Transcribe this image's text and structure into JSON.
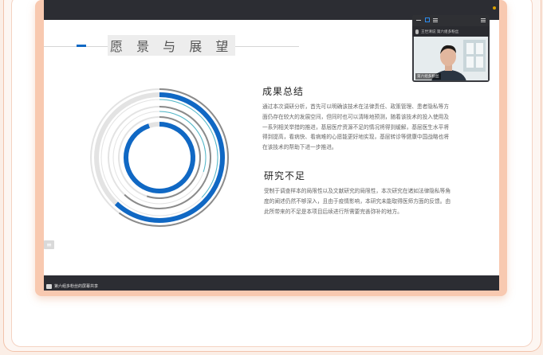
{
  "slide": {
    "title": "愿 景 与 展 望",
    "section1": {
      "heading": "成果总结",
      "body": "通过本次调研分析，首先可以明确该技术在法律责任、政策管理、患者隐私等方面仍存在较大的发展空间，但同时也可以清晰地预测，随着该技术的投入使用及一系列相关举措的推进，基层医疗资源不足的情况将得到缓解，基层医生水平将得到提高，看病快、看病难的心愿能更好地实现，基层转诊等健康中国战略也将在该技术的帮助下进一步推进。"
    },
    "section2": {
      "heading": "研究不足",
      "body": "受制于调查样本的局限性以及文献研究的局限性，本次研究在诸如法律隐私等角度的阐述仍然不够深入，且由于疫情影响，本研究未能取得医师方面的反馈。由此所带来的不足是本项目后续进行所需要完善弥补的地方。"
    },
    "side_tab_icon": "menu-icon"
  },
  "chart_data": {
    "type": "radial-bar",
    "series": [
      {
        "ring": 1,
        "value": 0.6,
        "color": "#8b8b8b"
      },
      {
        "ring": 2,
        "value": 0.62,
        "color": "#1068c4"
      },
      {
        "ring": 3,
        "value": 0.37,
        "color": "#4fb7c9"
      },
      {
        "ring": 4,
        "value": 0.62,
        "color": "#8b8b8b"
      },
      {
        "ring": 5,
        "value": 0.3,
        "color": "#4fb7c9"
      },
      {
        "ring": 6,
        "value": 0.55,
        "color": "#8b8b8b"
      },
      {
        "ring": 7,
        "value": 0.95,
        "color": "#1068c4"
      }
    ]
  },
  "video_panel": {
    "name_row": "王世清说 第六组多粉丝",
    "label": "第六组多粉丝"
  },
  "recording": {
    "text": "第六组多粉丝的屏幕共享"
  },
  "colors": {
    "accent": "#1068c4",
    "teal": "#4fb7c9",
    "grey_ring": "#8b8b8b",
    "track": "#e3e3e3",
    "frame": "#f8c9b0"
  }
}
